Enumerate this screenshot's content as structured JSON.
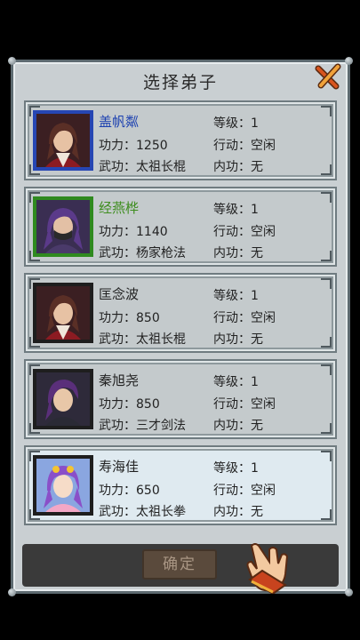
{
  "dialog": {
    "title": "选择弟子",
    "confirm_label": "确定"
  },
  "colors": {
    "panel": "#c9cfd2",
    "frame_blue": "#2646b3",
    "frame_green": "#2f8a1f",
    "frame_dark": "#1e1e1e",
    "name_blue": "#1a3fb0",
    "name_green": "#3e8d1f",
    "name_default": "#222222"
  },
  "disciples": [
    {
      "name": "盖帆粼",
      "power_label": "功力：1250",
      "martial_label": "武功：太祖长棍",
      "level_label": "等级：1",
      "action_label": "行动：空闲",
      "inner_label": "内功：无",
      "rank": "blue",
      "avatar": "red-robed-swordsman-portrait"
    },
    {
      "name": "经燕桦",
      "power_label": "功力：1140",
      "martial_label": "武功：杨家枪法",
      "level_label": "等级：1",
      "action_label": "行动：空闲",
      "inner_label": "内功：无",
      "rank": "green",
      "avatar": "masked-purple-haired-portrait"
    },
    {
      "name": "匡念波",
      "power_label": "功力：850",
      "martial_label": "武功：太祖长棍",
      "level_label": "等级：1",
      "action_label": "行动：空闲",
      "inner_label": "内功：无",
      "rank": "white",
      "avatar": "red-robed-swordsman-portrait"
    },
    {
      "name": "秦旭尧",
      "power_label": "功力：850",
      "martial_label": "武功：三才剑法",
      "level_label": "等级：1",
      "action_label": "行动：空闲",
      "inner_label": "内功：无",
      "rank": "white",
      "avatar": "purple-haired-youth-portrait"
    },
    {
      "name": "寿海佳",
      "power_label": "功力：650",
      "martial_label": "武功：太祖长拳",
      "level_label": "等级：1",
      "action_label": "行动：空闲",
      "inner_label": "内功：无",
      "rank": "white",
      "avatar": "pink-girl-portrait"
    }
  ]
}
